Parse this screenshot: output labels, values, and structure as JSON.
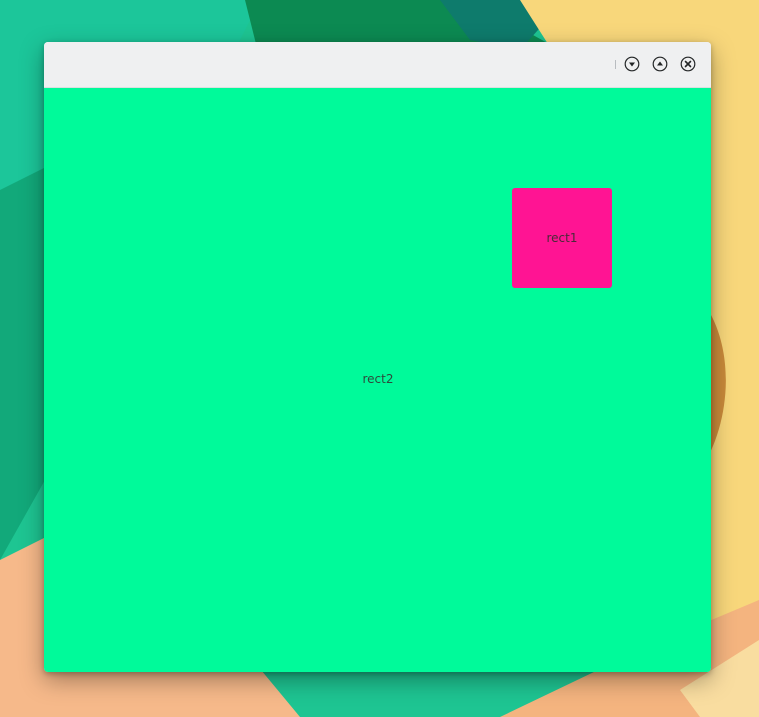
{
  "window": {
    "title": "",
    "buttons": {
      "minimize_icon": "chevron-down-circle-icon",
      "maximize_icon": "chevron-up-circle-icon",
      "close_icon": "close-circle-icon"
    }
  },
  "content": {
    "rect1": {
      "label": "rect1",
      "color": "#ff1493"
    },
    "rect2": {
      "label": "rect2",
      "color": "#00fa9a"
    }
  },
  "colors": {
    "titlebar": "#eff0f1",
    "icon": "#232627",
    "wallpaper_teal": "#1dbf8d",
    "wallpaper_dark_green": "#0f8a55",
    "wallpaper_yellow": "#f7d67a",
    "wallpaper_peach": "#f6b98a"
  }
}
